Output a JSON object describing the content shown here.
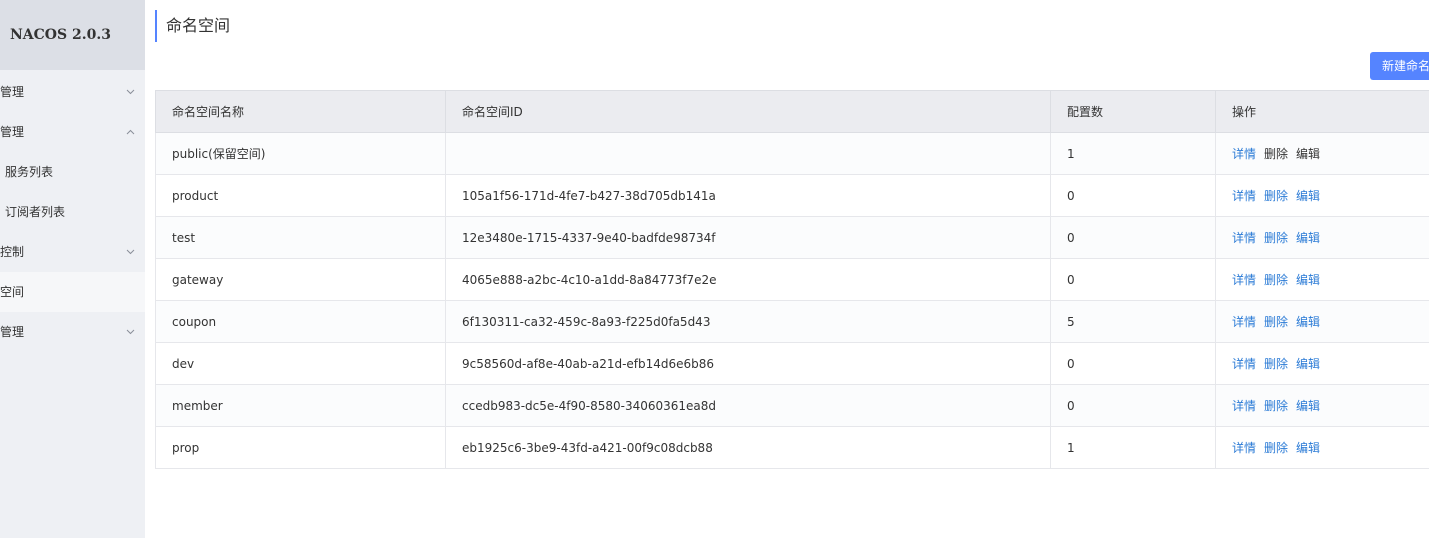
{
  "app": {
    "logo": "NACOS 2.0.3"
  },
  "sidebar": {
    "items": [
      {
        "label": "置管理",
        "chevron": "down"
      },
      {
        "label": "务管理",
        "chevron": "up"
      },
      {
        "label": "服务列表",
        "sub": true
      },
      {
        "label": "订阅者列表",
        "sub": true
      },
      {
        "label": "限控制",
        "chevron": "down"
      },
      {
        "label": "名空间",
        "active": true
      },
      {
        "label": "群管理",
        "chevron": "down"
      }
    ]
  },
  "page": {
    "title": "命名空间",
    "new_button": "新建命名"
  },
  "table": {
    "headers": [
      "命名空间名称",
      "命名空间ID",
      "配置数",
      "操作"
    ],
    "rows": [
      {
        "name": "public(保留空间)",
        "id": "",
        "count": "1"
      },
      {
        "name": "product",
        "id": "105a1f56-171d-4fe7-b427-38d705db141a",
        "count": "0"
      },
      {
        "name": "test",
        "id": "12e3480e-1715-4337-9e40-badfde98734f",
        "count": "0"
      },
      {
        "name": "gateway",
        "id": "4065e888-a2bc-4c10-a1dd-8a84773f7e2e",
        "count": "0"
      },
      {
        "name": "coupon",
        "id": "6f130311-ca32-459c-8a93-f225d0fa5d43",
        "count": "5"
      },
      {
        "name": "dev",
        "id": "9c58560d-af8e-40ab-a21d-efb14d6e6b86",
        "count": "0"
      },
      {
        "name": "member",
        "id": "ccedb983-dc5e-4f90-8580-34060361ea8d",
        "count": "0"
      },
      {
        "name": "prop",
        "id": "eb1925c6-3be9-43fd-a421-00f9c08dcb88",
        "count": "1"
      }
    ],
    "actions": {
      "detail": "详情",
      "delete": "删除",
      "edit": "编辑"
    }
  },
  "colors": {
    "accent": "#5584ff",
    "link": "#2b7bd6"
  }
}
